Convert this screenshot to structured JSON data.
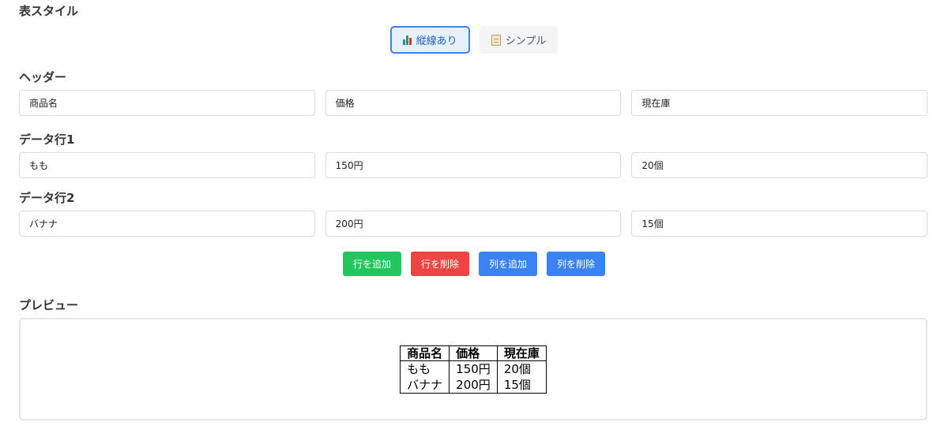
{
  "style_section": {
    "label": "表スタイル",
    "options": [
      {
        "label": "縦線あり",
        "icon": "bar-chart-icon",
        "active": true
      },
      {
        "label": "シンプル",
        "icon": "memo-icon",
        "active": false
      }
    ]
  },
  "header_section": {
    "label": "ヘッダー",
    "values": [
      "商品名",
      "価格",
      "現在庫"
    ]
  },
  "data_rows": [
    {
      "label": "データ行1",
      "values": [
        "もも",
        "150円",
        "20個"
      ]
    },
    {
      "label": "データ行2",
      "values": [
        "バナナ",
        "200円",
        "15個"
      ]
    }
  ],
  "actions": {
    "add_row": "行を追加",
    "delete_row": "行を削除",
    "add_column": "列を追加",
    "delete_column": "列を削除"
  },
  "colors": {
    "add_row": "#22c55e",
    "delete_row": "#ef4444",
    "column_buttons": "#3b82f6"
  },
  "preview": {
    "label": "プレビュー",
    "headers": [
      "商品名",
      "価格",
      "現在庫"
    ],
    "rows": [
      [
        "もも",
        "150円",
        "20個"
      ],
      [
        "バナナ",
        "200円",
        "15個"
      ]
    ]
  }
}
